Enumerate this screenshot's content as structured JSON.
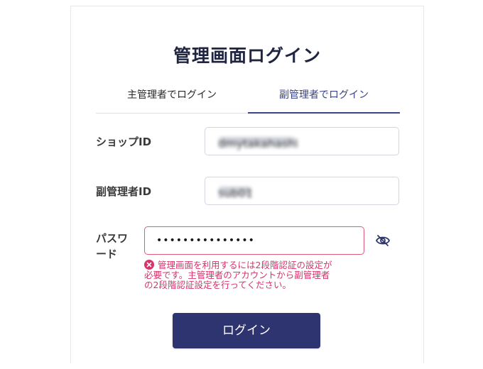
{
  "page": {
    "title": "管理画面ログイン"
  },
  "tabs": [
    {
      "label": "主管理者でログイン",
      "active": false
    },
    {
      "label": "副管理者でログイン",
      "active": true
    }
  ],
  "fields": {
    "shop_id": {
      "label": "ショップID",
      "value": "dmytakahashi"
    },
    "sub_admin_id": {
      "label": "副管理者ID",
      "value": "sub01"
    },
    "password": {
      "label_line1": "パスワ",
      "label_line2": "ード",
      "masked_value": "•••••••••••••••",
      "visibility_icon": "eye-slash-icon"
    }
  },
  "error": {
    "icon": "error-circle-icon",
    "message_line1": "管理画面を利用するには2段階認証の設定が",
    "message_line2": "必要です。主管理者のアカウントから副管理者",
    "message_line3": "の2段階認証設定を行ってください。"
  },
  "actions": {
    "login_label": "ログイン"
  },
  "colors": {
    "primary": "#2d3470",
    "tab_active": "#3b4484",
    "error": "#d8336a"
  }
}
